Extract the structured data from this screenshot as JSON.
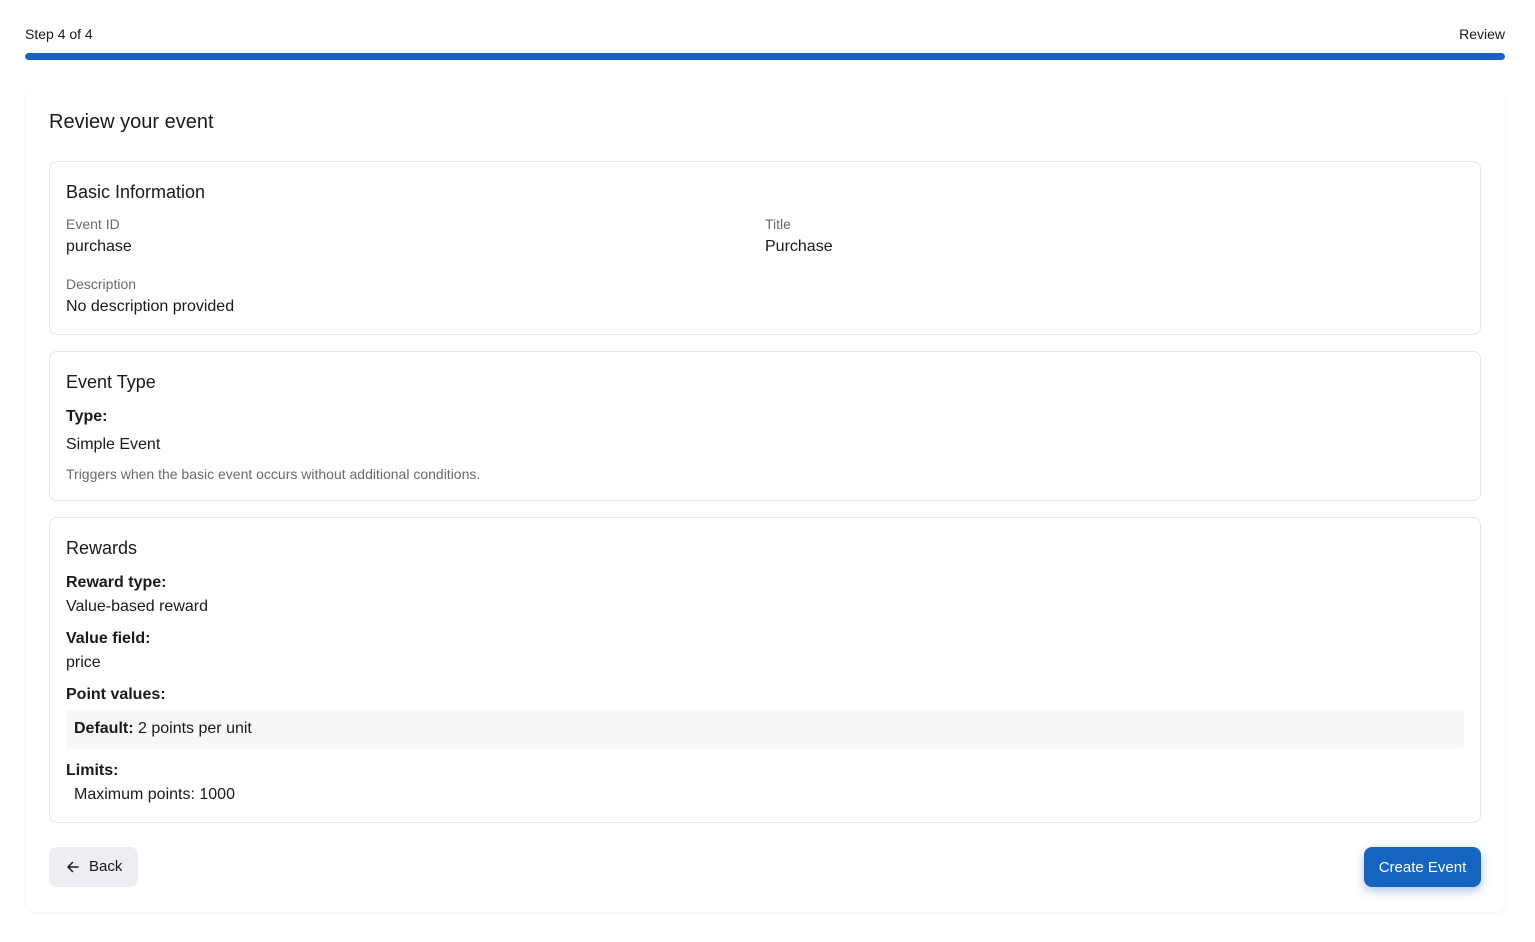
{
  "progress": {
    "step_label": "Step 4 of 4",
    "step_name": "Review",
    "fraction": 1.0,
    "color": "#1565c0"
  },
  "page": {
    "title": "Review your event"
  },
  "basic_info": {
    "heading": "Basic Information",
    "event_id_label": "Event ID",
    "event_id_value": "purchase",
    "title_label": "Title",
    "title_value": "Purchase",
    "description_label": "Description",
    "description_value": "No description provided"
  },
  "event_type": {
    "heading": "Event Type",
    "type_label": "Type:",
    "type_value": "Simple Event",
    "type_description": "Triggers when the basic event occurs without additional conditions."
  },
  "rewards": {
    "heading": "Rewards",
    "reward_type_label": "Reward type:",
    "reward_type_value": "Value-based reward",
    "value_field_label": "Value field:",
    "value_field_value": "price",
    "point_values_label": "Point values:",
    "default_label": "Default:",
    "default_value": "2 points per unit",
    "limits_label": "Limits:",
    "max_points": "Maximum points: 1000"
  },
  "actions": {
    "back_label": "Back",
    "back_icon": "arrow-left-icon",
    "create_label": "Create Event",
    "accent": "#1565c0"
  }
}
